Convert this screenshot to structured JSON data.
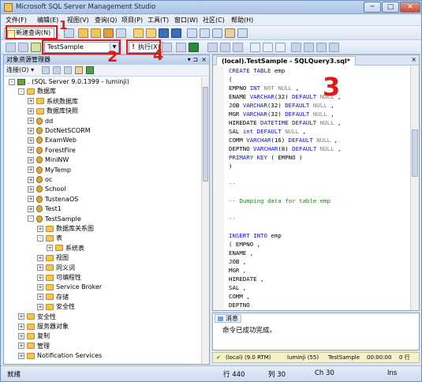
{
  "window": {
    "title": "Microsoft SQL Server Management Studio",
    "min": "─",
    "max": "□",
    "close": "✕"
  },
  "menu": [
    "文件(F)",
    "编辑(E)",
    "视图(V)",
    "查询(Q)",
    "项目(P)",
    "工具(T)",
    "窗口(W)",
    "社区(C)",
    "帮助(H)"
  ],
  "toolbar": {
    "new_query": "新建查询(N)",
    "database": "TestSample",
    "execute": "执行(X)"
  },
  "annotations": [
    "1",
    "2",
    "3",
    "4"
  ],
  "explorer": {
    "title": "对象资源管理器",
    "pin": "▾ ⊐",
    "close": "×",
    "connect": "连接(O) ▾",
    "tree": [
      {
        "label": ". (SQL Server 9.0.1399 - luminji)",
        "exp": "-",
        "icon": "srv",
        "level": 0
      },
      {
        "label": "数据库",
        "exp": "-",
        "icon": "folder",
        "level": 1
      },
      {
        "label": "系统数据库",
        "exp": "+",
        "icon": "folder",
        "level": 2
      },
      {
        "label": "数据库快照",
        "exp": "+",
        "icon": "folder",
        "level": 2
      },
      {
        "label": "dd",
        "exp": "+",
        "icon": "db",
        "level": 2
      },
      {
        "label": "DotNetSCORM",
        "exp": "+",
        "icon": "db",
        "level": 2
      },
      {
        "label": "ExamWeb",
        "exp": "+",
        "icon": "db",
        "level": 2
      },
      {
        "label": "ForestFire",
        "exp": "+",
        "icon": "db",
        "level": 2
      },
      {
        "label": "MiniNW",
        "exp": "+",
        "icon": "db",
        "level": 2
      },
      {
        "label": "MyTemp",
        "exp": "+",
        "icon": "db",
        "level": 2
      },
      {
        "label": "oc",
        "exp": "+",
        "icon": "db",
        "level": 2
      },
      {
        "label": "School",
        "exp": "+",
        "icon": "db",
        "level": 2
      },
      {
        "label": "TustenaOS",
        "exp": "+",
        "icon": "db",
        "level": 2
      },
      {
        "label": "Test1",
        "exp": "+",
        "icon": "db",
        "level": 2
      },
      {
        "label": "TestSample",
        "exp": "-",
        "icon": "db",
        "level": 2
      },
      {
        "label": "数据库关系图",
        "exp": "+",
        "icon": "folder",
        "level": 3
      },
      {
        "label": "表",
        "exp": "-",
        "icon": "folder",
        "level": 3
      },
      {
        "label": "系统表",
        "exp": "+",
        "icon": "folder",
        "level": 4
      },
      {
        "label": "视图",
        "exp": "+",
        "icon": "folder",
        "level": 3
      },
      {
        "label": "同义词",
        "exp": "+",
        "icon": "folder",
        "level": 3
      },
      {
        "label": "可编程性",
        "exp": "+",
        "icon": "folder",
        "level": 3
      },
      {
        "label": "Service Broker",
        "exp": "+",
        "icon": "folder",
        "level": 3
      },
      {
        "label": "存储",
        "exp": "+",
        "icon": "folder",
        "level": 3
      },
      {
        "label": "安全性",
        "exp": "+",
        "icon": "folder",
        "level": 3
      },
      {
        "label": "安全性",
        "exp": "+",
        "icon": "folder",
        "level": 1
      },
      {
        "label": "服务器对象",
        "exp": "+",
        "icon": "folder",
        "level": 1
      },
      {
        "label": "复制",
        "exp": "+",
        "icon": "folder",
        "level": 1
      },
      {
        "label": "管理",
        "exp": "+",
        "icon": "folder",
        "level": 1
      },
      {
        "label": "Notification Services",
        "exp": "+",
        "icon": "folder",
        "level": 1
      }
    ]
  },
  "editor": {
    "tab": "(local).TestSample - SQLQuery3.sql*",
    "tab_close": "×",
    "lines": [
      "CREATE TABLE emp",
      "(",
      "EMPNO INT NOT NULL ,",
      "ENAME VARCHAR(32) DEFAULT NULL ,",
      "JOB VARCHAR(32) DEFAULT NULL ,",
      "MGR VARCHAR(32) DEFAULT NULL ,",
      "HIREDATE DATETIME DEFAULT NULL ,",
      "SAL int DEFAULT NULL ,",
      "COMM VARCHAR(16) DEFAULT NULL ,",
      "DEPTNO VARCHAR(8) DEFAULT NULL ,",
      "PRIMARY KEY ( EMPNO )",
      ")",
      "",
      "--",
      "",
      "-- Dumping data for table emp",
      "",
      "--",
      "",
      "INSERT INTO emp",
      "( EMPNO ,",
      "ENAME ,",
      "JOB ,",
      "MGR ,",
      "HIREDATE ,",
      "SAL ,",
      "COMM ,",
      "DEPTNO"
    ]
  },
  "messages": {
    "tab": "消息",
    "text": "命令已成功完成。"
  },
  "query_status": {
    "ok": "✔",
    "server": "(local) (9.0 RTM)",
    "user": "luminji (55)",
    "database": "TestSample",
    "time": "00:00:00",
    "rows": "0 行"
  },
  "statusbar": {
    "ready": "就绪",
    "line": "行 440",
    "col": "列 30",
    "ch": "Ch 30",
    "ins": "Ins"
  },
  "colors": {
    "keyword": "#1010d0",
    "null_gray": "#808080",
    "comment": "#208020",
    "annotation_red": "#e01818"
  }
}
